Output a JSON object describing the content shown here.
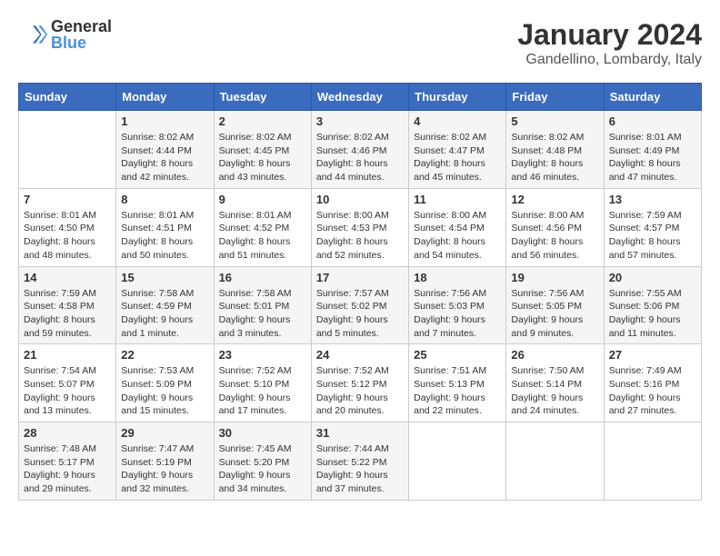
{
  "header": {
    "logo_line1": "General",
    "logo_line2": "Blue",
    "title": "January 2024",
    "subtitle": "Gandellino, Lombardy, Italy"
  },
  "columns": [
    "Sunday",
    "Monday",
    "Tuesday",
    "Wednesday",
    "Thursday",
    "Friday",
    "Saturday"
  ],
  "weeks": [
    [
      {
        "day": "",
        "info": ""
      },
      {
        "day": "1",
        "info": "Sunrise: 8:02 AM\nSunset: 4:44 PM\nDaylight: 8 hours\nand 42 minutes."
      },
      {
        "day": "2",
        "info": "Sunrise: 8:02 AM\nSunset: 4:45 PM\nDaylight: 8 hours\nand 43 minutes."
      },
      {
        "day": "3",
        "info": "Sunrise: 8:02 AM\nSunset: 4:46 PM\nDaylight: 8 hours\nand 44 minutes."
      },
      {
        "day": "4",
        "info": "Sunrise: 8:02 AM\nSunset: 4:47 PM\nDaylight: 8 hours\nand 45 minutes."
      },
      {
        "day": "5",
        "info": "Sunrise: 8:02 AM\nSunset: 4:48 PM\nDaylight: 8 hours\nand 46 minutes."
      },
      {
        "day": "6",
        "info": "Sunrise: 8:01 AM\nSunset: 4:49 PM\nDaylight: 8 hours\nand 47 minutes."
      }
    ],
    [
      {
        "day": "7",
        "info": "Sunrise: 8:01 AM\nSunset: 4:50 PM\nDaylight: 8 hours\nand 48 minutes."
      },
      {
        "day": "8",
        "info": "Sunrise: 8:01 AM\nSunset: 4:51 PM\nDaylight: 8 hours\nand 50 minutes."
      },
      {
        "day": "9",
        "info": "Sunrise: 8:01 AM\nSunset: 4:52 PM\nDaylight: 8 hours\nand 51 minutes."
      },
      {
        "day": "10",
        "info": "Sunrise: 8:00 AM\nSunset: 4:53 PM\nDaylight: 8 hours\nand 52 minutes."
      },
      {
        "day": "11",
        "info": "Sunrise: 8:00 AM\nSunset: 4:54 PM\nDaylight: 8 hours\nand 54 minutes."
      },
      {
        "day": "12",
        "info": "Sunrise: 8:00 AM\nSunset: 4:56 PM\nDaylight: 8 hours\nand 56 minutes."
      },
      {
        "day": "13",
        "info": "Sunrise: 7:59 AM\nSunset: 4:57 PM\nDaylight: 8 hours\nand 57 minutes."
      }
    ],
    [
      {
        "day": "14",
        "info": "Sunrise: 7:59 AM\nSunset: 4:58 PM\nDaylight: 8 hours\nand 59 minutes."
      },
      {
        "day": "15",
        "info": "Sunrise: 7:58 AM\nSunset: 4:59 PM\nDaylight: 9 hours\nand 1 minute."
      },
      {
        "day": "16",
        "info": "Sunrise: 7:58 AM\nSunset: 5:01 PM\nDaylight: 9 hours\nand 3 minutes."
      },
      {
        "day": "17",
        "info": "Sunrise: 7:57 AM\nSunset: 5:02 PM\nDaylight: 9 hours\nand 5 minutes."
      },
      {
        "day": "18",
        "info": "Sunrise: 7:56 AM\nSunset: 5:03 PM\nDaylight: 9 hours\nand 7 minutes."
      },
      {
        "day": "19",
        "info": "Sunrise: 7:56 AM\nSunset: 5:05 PM\nDaylight: 9 hours\nand 9 minutes."
      },
      {
        "day": "20",
        "info": "Sunrise: 7:55 AM\nSunset: 5:06 PM\nDaylight: 9 hours\nand 11 minutes."
      }
    ],
    [
      {
        "day": "21",
        "info": "Sunrise: 7:54 AM\nSunset: 5:07 PM\nDaylight: 9 hours\nand 13 minutes."
      },
      {
        "day": "22",
        "info": "Sunrise: 7:53 AM\nSunset: 5:09 PM\nDaylight: 9 hours\nand 15 minutes."
      },
      {
        "day": "23",
        "info": "Sunrise: 7:52 AM\nSunset: 5:10 PM\nDaylight: 9 hours\nand 17 minutes."
      },
      {
        "day": "24",
        "info": "Sunrise: 7:52 AM\nSunset: 5:12 PM\nDaylight: 9 hours\nand 20 minutes."
      },
      {
        "day": "25",
        "info": "Sunrise: 7:51 AM\nSunset: 5:13 PM\nDaylight: 9 hours\nand 22 minutes."
      },
      {
        "day": "26",
        "info": "Sunrise: 7:50 AM\nSunset: 5:14 PM\nDaylight: 9 hours\nand 24 minutes."
      },
      {
        "day": "27",
        "info": "Sunrise: 7:49 AM\nSunset: 5:16 PM\nDaylight: 9 hours\nand 27 minutes."
      }
    ],
    [
      {
        "day": "28",
        "info": "Sunrise: 7:48 AM\nSunset: 5:17 PM\nDaylight: 9 hours\nand 29 minutes."
      },
      {
        "day": "29",
        "info": "Sunrise: 7:47 AM\nSunset: 5:19 PM\nDaylight: 9 hours\nand 32 minutes."
      },
      {
        "day": "30",
        "info": "Sunrise: 7:45 AM\nSunset: 5:20 PM\nDaylight: 9 hours\nand 34 minutes."
      },
      {
        "day": "31",
        "info": "Sunrise: 7:44 AM\nSunset: 5:22 PM\nDaylight: 9 hours\nand 37 minutes."
      },
      {
        "day": "",
        "info": ""
      },
      {
        "day": "",
        "info": ""
      },
      {
        "day": "",
        "info": ""
      }
    ]
  ]
}
